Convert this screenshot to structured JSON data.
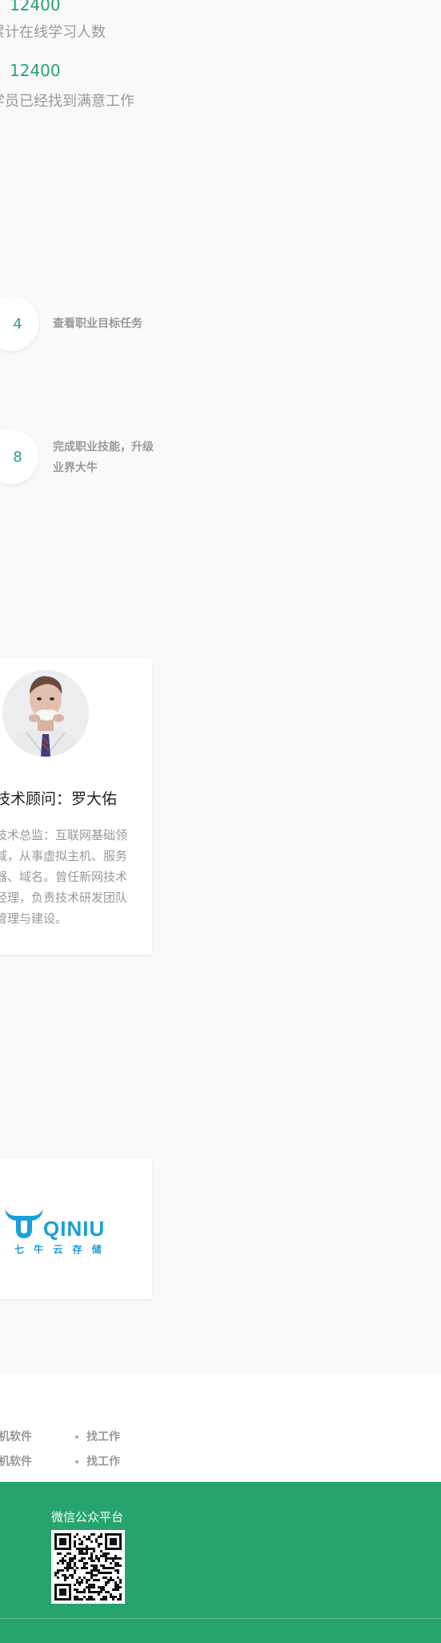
{
  "stats": [
    {
      "number": "12400",
      "label": "累计在线学习人数"
    },
    {
      "number": "12400",
      "label": "学员已经找到满意工作"
    }
  ],
  "steps": [
    {
      "number": "4",
      "text": "查看职业目标任务"
    },
    {
      "number": "8",
      "text": "完成职业技能，升级业界大牛"
    }
  ],
  "teacher": {
    "title": "技术顾问：罗大佑",
    "description": "技术总监：互联网基础领域，从事虚拟主机、服务器、域名。曾任新网技术经理，负责技术研发团队管理与建设。"
  },
  "partner": {
    "name": "QINIU",
    "subtitle": "七 牛 云 存 储",
    "color": "#1a9fd8"
  },
  "footer_links": {
    "left": [
      "机软件",
      "机软件"
    ],
    "right": [
      "找工作",
      "找工作"
    ]
  },
  "footer": {
    "wechat_label": "微信公众平台"
  },
  "colors": {
    "accent": "#27a46e"
  }
}
